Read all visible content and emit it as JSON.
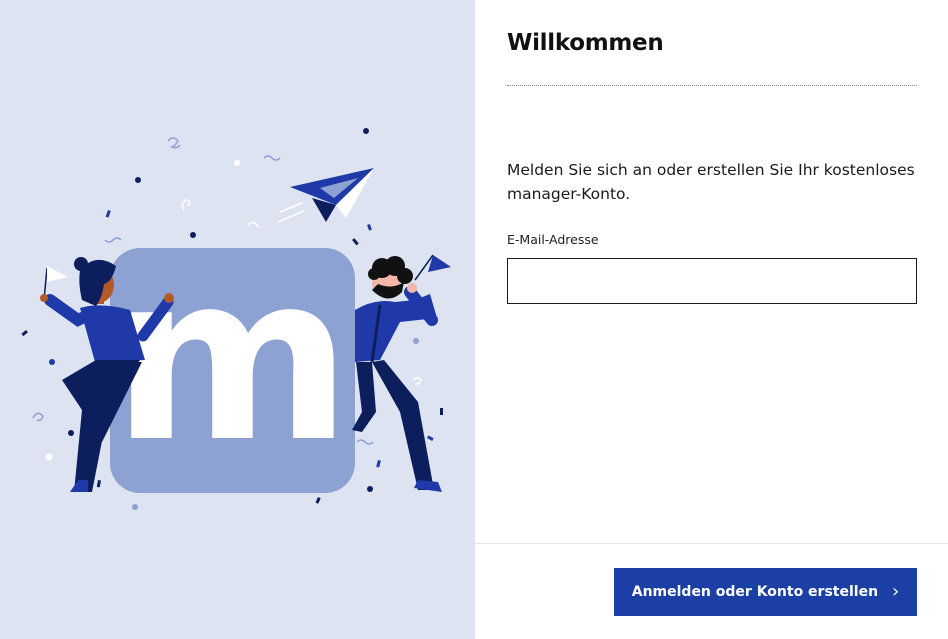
{
  "illustration": {
    "logo_letter": "m",
    "colors": {
      "background": "#dde3f1",
      "logo_tile": "#8da1d3",
      "navy": "#0d1e5c",
      "royal_blue": "#1f3aa8"
    }
  },
  "form": {
    "title": "Willkommen",
    "intro": "Melden Sie sich an oder erstellen Sie Ihr kostenloses manager-Konto.",
    "email_label": "E-Mail-Adresse",
    "email_value": "",
    "email_placeholder": "",
    "submit_label": "Anmelden oder Konto erstellen",
    "submit_icon": "chevron-right-icon",
    "submit_icon_glyph": "›",
    "accent_color": "#1c3fa6"
  }
}
